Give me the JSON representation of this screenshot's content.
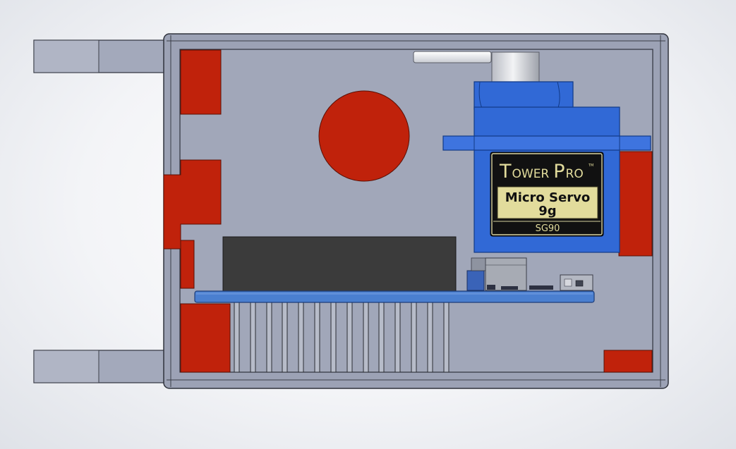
{
  "servo": {
    "brand_first_initial": "T",
    "brand_first_rest": "OWER",
    "brand_second_initial": "P",
    "brand_second_rest": "RO",
    "trademark": "TM",
    "product_line1": "Micro Servo",
    "product_line2": "9g",
    "model": "SG90"
  },
  "colors": {
    "housing": "#a0a6b8",
    "housing_edge": "#3a3d48",
    "cutout_red": "#c0220b",
    "servo_blue": "#3169d6",
    "pcb_blue": "#4a7fd0",
    "component_dark": "#3b3b3b",
    "label_black": "#111111",
    "label_gold": "#e2dc9c"
  }
}
